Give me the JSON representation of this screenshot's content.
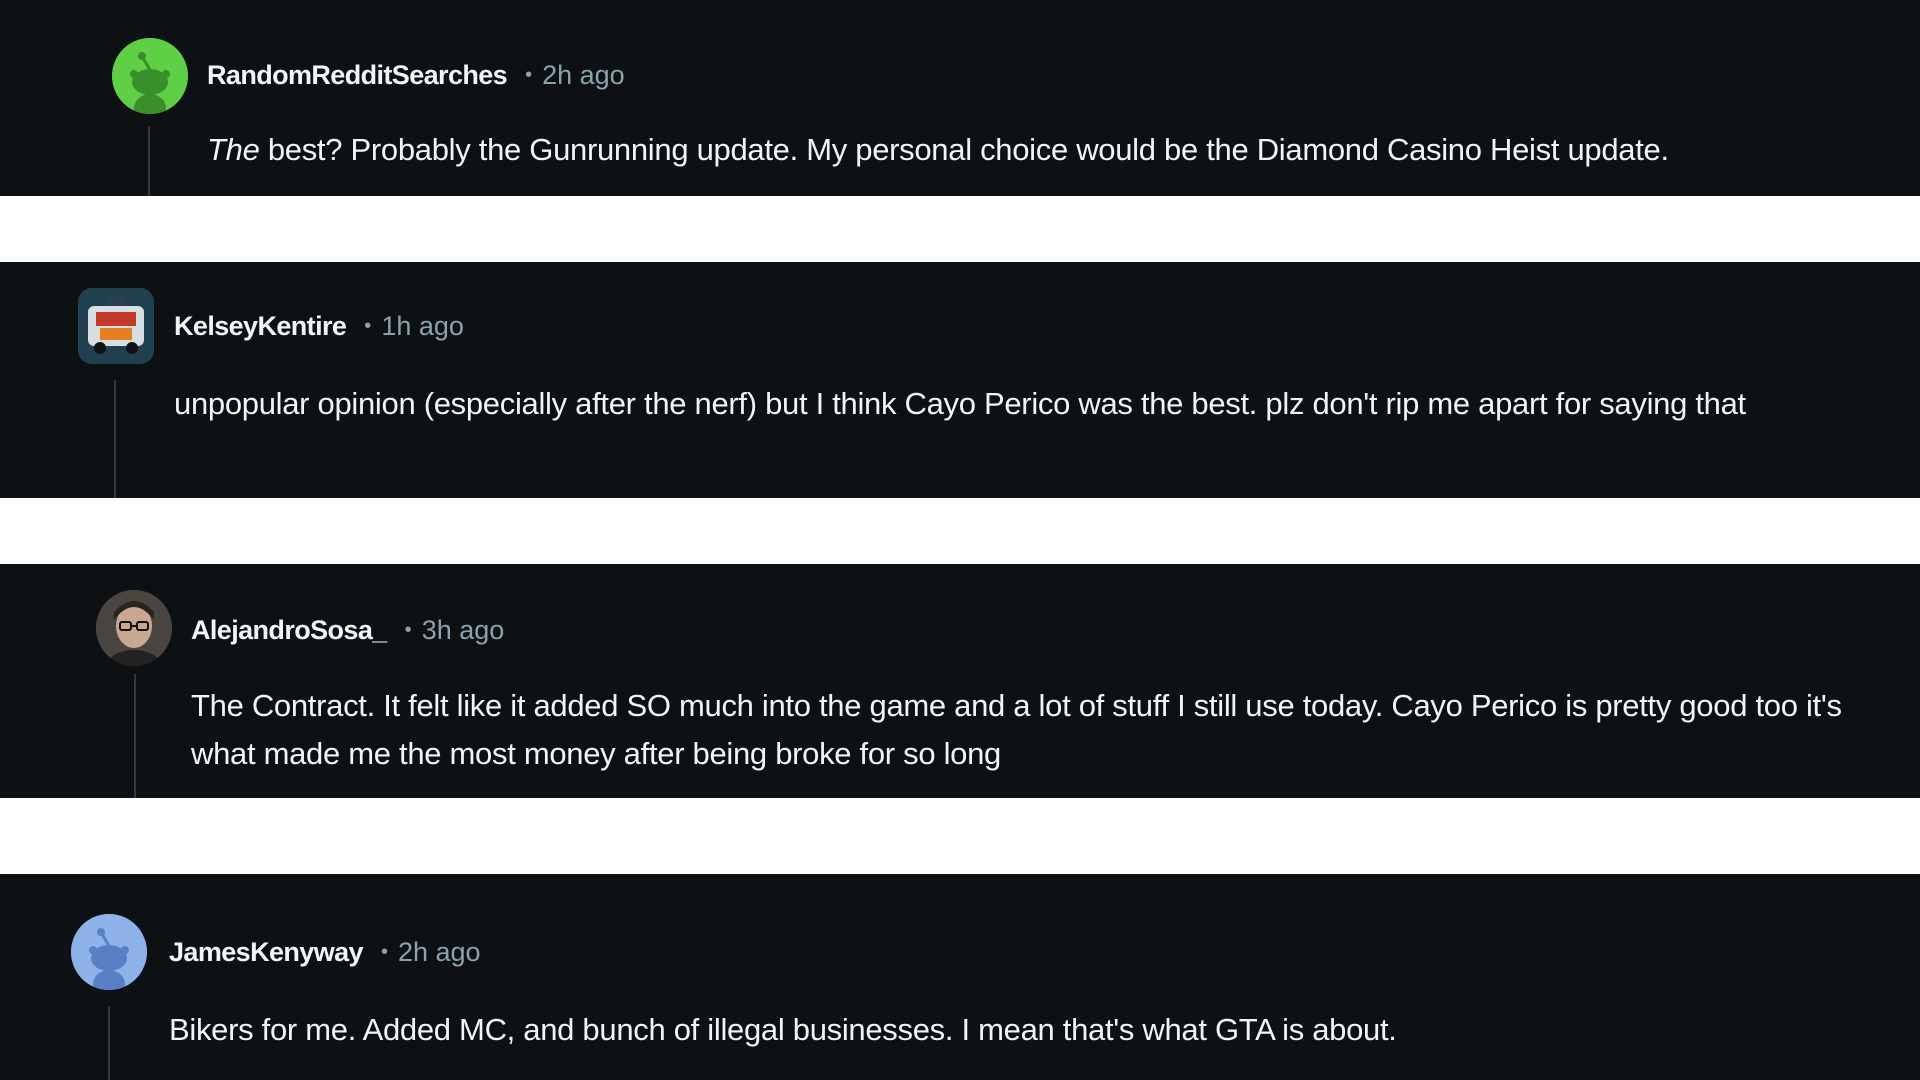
{
  "comments": [
    {
      "username": "RandomRedditSearches",
      "time": "2h ago",
      "avatar": "snoo-green-avatar",
      "body_emphasis": "The",
      "body_rest": " best? Probably the Gunrunning update. My personal choice would be the Diamond Casino Heist update."
    },
    {
      "username": "KelseyKentire",
      "time": "1h ago",
      "avatar": "truck-avatar",
      "body": "unpopular opinion (especially after the nerf) but I think Cayo Perico was the best. plz don't rip me apart for saying that"
    },
    {
      "username": "AlejandroSosa_",
      "time": "3h ago",
      "avatar": "person-photo-avatar",
      "body": "The Contract. It felt like it added SO much into the game and a lot of stuff I still use today. Cayo Perico is pretty good too it's what made me the most money after being broke for so long"
    },
    {
      "username": "JamesKenyway",
      "time": "2h ago",
      "avatar": "snoo-blue-avatar",
      "body": "Bikers for me. Added MC, and bunch of illegal businesses. I mean that's what GTA is about."
    }
  ],
  "colors": {
    "panel_bg": "#0e1113",
    "text": "#f2f4f5",
    "meta": "#8ba2ad",
    "gap": "#ffffff"
  }
}
